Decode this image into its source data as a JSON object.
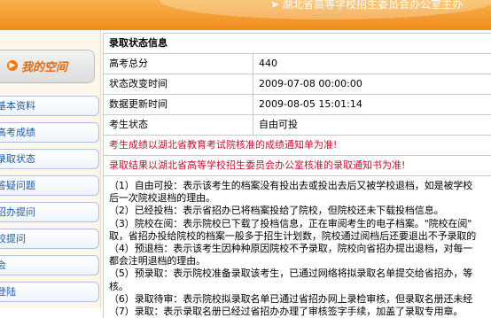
{
  "banner": {
    "title": "湖北省高等学校招生委员会办公室主办"
  },
  "sidebar": {
    "space_title": "我的空间",
    "items": [
      {
        "label": "基本资料"
      },
      {
        "label": "高考成绩"
      },
      {
        "label": "录取状态"
      },
      {
        "label": "答疑问题"
      },
      {
        "label": "招办提问"
      },
      {
        "label": "校提问"
      },
      {
        "label": "会"
      },
      {
        "label": "登陆"
      }
    ]
  },
  "main": {
    "title": "录取状态信息",
    "rows": [
      {
        "key": "高考总分",
        "value": "440"
      },
      {
        "key": "状态改变时间",
        "value": "2009-07-08 00:00:00"
      },
      {
        "key": "数据更新时间",
        "value": "2009-08-05 15:01:14"
      },
      {
        "key": "考生状态",
        "value": "自由可投"
      }
    ],
    "notices": [
      "考生成绩以湖北省教育考试院核准的成绩通知单为准!",
      "录取结果以湖北省高等学校招生委员会办公室核准的录取通知书为准!"
    ],
    "definitions": [
      "（1）自由可投：表示该考生的档案没有投出去或投出去后又被学校退档，如是被学校",
      "后一次院校退档的理由。",
      "（2）已经投档：表示省招办已将档案投给了院校，但院校还未下载投档信息。",
      "（3）院校在阅：表示院校已下载了投档信息，正在审阅考生的电子档案。\"院校在阅\"",
      "取，省招办投给院校的档案一般多于招生计划数，院校通过阅档后还要退出不予录取的",
      "（4）预退档：表示该考生因种种原因院校不予录取，院校向省招办提出退档，对每一",
      "都会注明退档的理由。",
      "（5）预录取：表示院校准备录取该考生，已通过网络将拟录取名单提交给省招办，等",
      "核。",
      "（6）录取待审：表示院校拟录取名单已通过省招办网上录检审核，但录取名册还未经",
      "（7）录取：表示录取名册已经过省招办办理了审核签字手续，加盖了录取专用章。"
    ]
  }
}
